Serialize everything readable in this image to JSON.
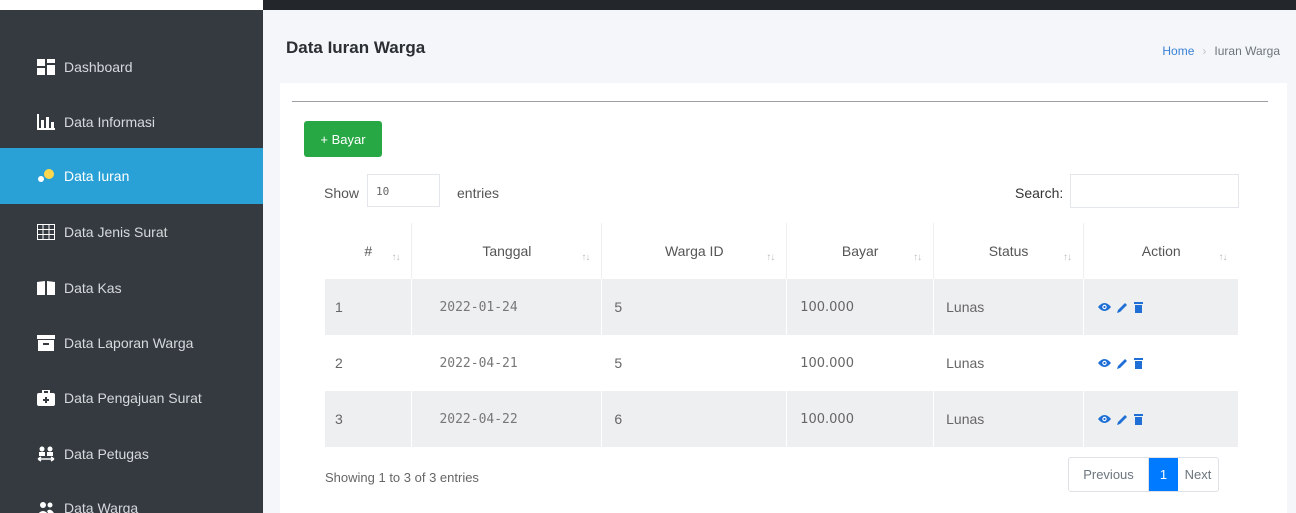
{
  "sidebar": {
    "items": [
      {
        "label": "Dashboard",
        "icon": "dashboard-icon"
      },
      {
        "label": "Data Informasi",
        "icon": "bar-chart-icon"
      },
      {
        "label": "Data Iuran",
        "icon": "dots-icon",
        "active": true
      },
      {
        "label": "Data Jenis Surat",
        "icon": "grid-icon"
      },
      {
        "label": "Data Kas",
        "icon": "book-icon"
      },
      {
        "label": "Data Laporan Warga",
        "icon": "archive-icon"
      },
      {
        "label": "Data Pengajuan Surat",
        "icon": "briefcase-icon"
      },
      {
        "label": "Data Petugas",
        "icon": "people-arrows-icon"
      },
      {
        "label": "Data Warga",
        "icon": "users-icon"
      }
    ]
  },
  "header": {
    "title": "Data Iuran Warga",
    "breadcrumb": {
      "home": "Home",
      "current": "Iuran Warga"
    }
  },
  "toolbar": {
    "add_label": "+ Bayar"
  },
  "table_controls": {
    "show_label": "Show",
    "page_length": "10",
    "entries_label": "entries",
    "search_label": "Search:",
    "search_value": ""
  },
  "table": {
    "columns": [
      "#",
      "Tanggal",
      "Warga ID",
      "Bayar",
      "Status",
      "Action"
    ],
    "sort_glyph": "↑↓",
    "rows": [
      {
        "no": "1",
        "tanggal": "2022-01-24",
        "warga_id": "5",
        "bayar": "100.000",
        "status": "Lunas"
      },
      {
        "no": "2",
        "tanggal": "2022-04-21",
        "warga_id": "5",
        "bayar": "100.000",
        "status": "Lunas"
      },
      {
        "no": "3",
        "tanggal": "2022-04-22",
        "warga_id": "6",
        "bayar": "100.000",
        "status": "Lunas"
      }
    ]
  },
  "footer": {
    "info": "Showing 1 to 3 of 3 entries",
    "pagination": {
      "previous": "Previous",
      "current": "1",
      "next": "Next"
    }
  },
  "colors": {
    "sidebar_bg": "#343a40",
    "active_item": "#2aa1d6",
    "add_button": "#28a745",
    "action_icon": "#1f6fd6",
    "page_active": "#007bff"
  }
}
